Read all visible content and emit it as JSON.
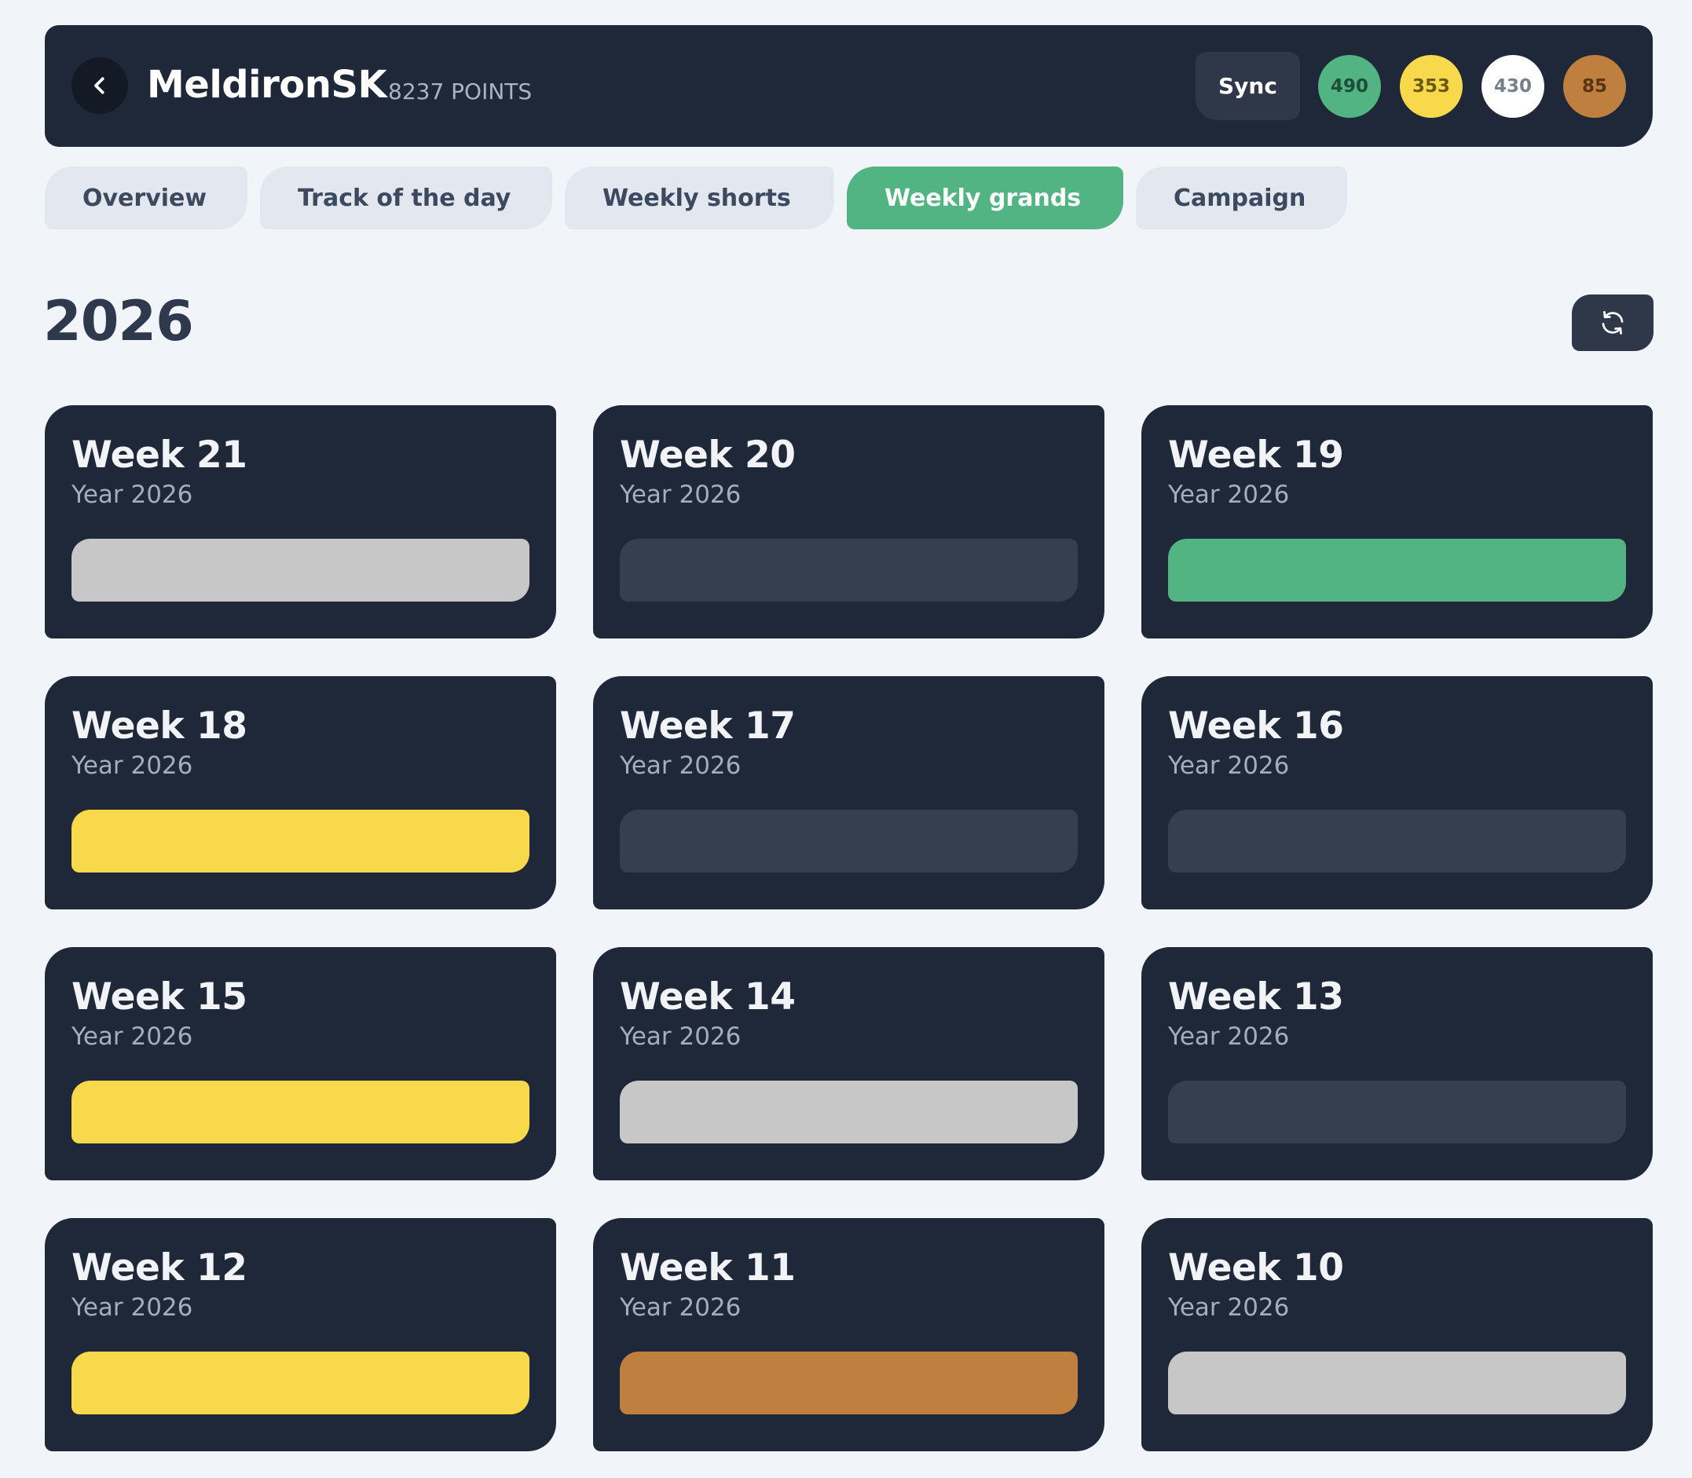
{
  "header": {
    "user_name": "MeldironSK",
    "points_label": "8237 POINTS",
    "sync_label": "Sync",
    "medals": [
      {
        "label": "490",
        "bg": "#52b383",
        "fg": "#1e4d39",
        "icon": "green-medal"
      },
      {
        "label": "353",
        "bg": "#f8d94b",
        "fg": "#6a5a0f",
        "icon": "gold-medal"
      },
      {
        "label": "430",
        "bg": "#ffffff",
        "fg": "#7a7f87",
        "icon": "silver-medal"
      },
      {
        "label": "85",
        "bg": "#bf7f3f",
        "fg": "#5a3315",
        "icon": "bronze-medal"
      }
    ]
  },
  "tabs": [
    {
      "label": "Overview",
      "active": false
    },
    {
      "label": "Track of the day",
      "active": false
    },
    {
      "label": "Weekly shorts",
      "active": false
    },
    {
      "label": "Weekly grands",
      "active": true
    },
    {
      "label": "Campaign",
      "active": false
    }
  ],
  "colors": {
    "active_tab": "#52b383",
    "bar_none": "#363f50",
    "bar_green": "#52b383",
    "bar_gold": "#f8d94b",
    "bar_silver": "#c7c7c7",
    "bar_bronze": "#bf7f3f"
  },
  "year": "2026",
  "weeks": [
    {
      "title": "Week 21",
      "subtitle": "Year 2026",
      "medal": "silver"
    },
    {
      "title": "Week 20",
      "subtitle": "Year 2026",
      "medal": "none"
    },
    {
      "title": "Week 19",
      "subtitle": "Year 2026",
      "medal": "green"
    },
    {
      "title": "Week 18",
      "subtitle": "Year 2026",
      "medal": "gold"
    },
    {
      "title": "Week 17",
      "subtitle": "Year 2026",
      "medal": "none"
    },
    {
      "title": "Week 16",
      "subtitle": "Year 2026",
      "medal": "none"
    },
    {
      "title": "Week 15",
      "subtitle": "Year 2026",
      "medal": "gold"
    },
    {
      "title": "Week 14",
      "subtitle": "Year 2026",
      "medal": "silver"
    },
    {
      "title": "Week 13",
      "subtitle": "Year 2026",
      "medal": "none"
    },
    {
      "title": "Week 12",
      "subtitle": "Year 2026",
      "medal": "gold"
    },
    {
      "title": "Week 11",
      "subtitle": "Year 2026",
      "medal": "bronze"
    },
    {
      "title": "Week 10",
      "subtitle": "Year 2026",
      "medal": "silver"
    }
  ]
}
